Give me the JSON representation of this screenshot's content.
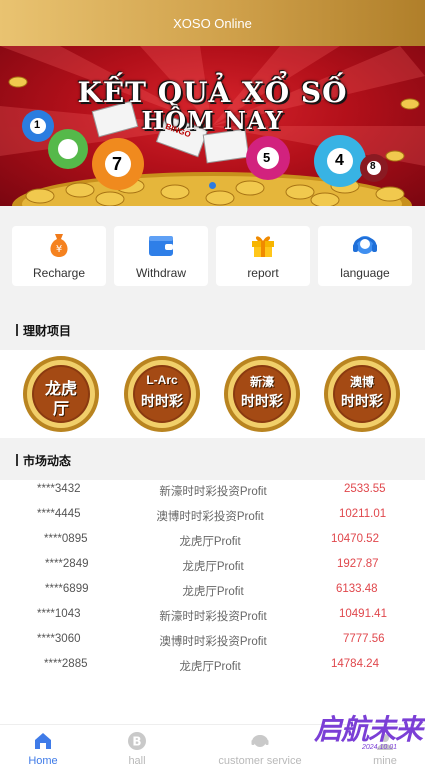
{
  "header": {
    "title": "XOSO Online"
  },
  "banner": {
    "line1": "KẾT QUẢ XỔ SỐ",
    "line2": "HÔM NAY",
    "ticket_text": "BINGO",
    "balls": [
      "1",
      "7",
      "5",
      "4",
      "8"
    ]
  },
  "quick_actions": [
    {
      "label": "Recharge",
      "icon": "money-bag-icon"
    },
    {
      "label": "Withdraw",
      "icon": "wallet-icon"
    },
    {
      "label": "report",
      "icon": "gift-icon"
    },
    {
      "label": "language",
      "icon": "headset-icon"
    }
  ],
  "projects_section": {
    "title": "理财项目"
  },
  "projects": [
    {
      "top": "龙虎",
      "bottom": "厅"
    },
    {
      "top": "L-Arc",
      "bottom": "时时彩"
    },
    {
      "top": "新濠",
      "bottom": "时时彩"
    },
    {
      "top": "澳博",
      "bottom": "时时彩"
    }
  ],
  "market_section": {
    "title": "市场动态"
  },
  "market": [
    {
      "user": "****3432",
      "project": "新濠时时彩投资Profit",
      "amount": "2533.55"
    },
    {
      "user": "****4445",
      "project": "澳博时时彩投资Profit",
      "amount": "10211.01"
    },
    {
      "user": "****0895",
      "project": "龙虎厅Profit",
      "amount": "10470.52"
    },
    {
      "user": "****2849",
      "project": "龙虎厅Profit",
      "amount": "1927.87"
    },
    {
      "user": "****6899",
      "project": "龙虎厅Profit",
      "amount": "6133.48"
    },
    {
      "user": "****1043",
      "project": "新濠时时彩投资Profit",
      "amount": "10491.41"
    },
    {
      "user": "****3060",
      "project": "澳博时时彩投资Profit",
      "amount": "7777.56"
    },
    {
      "user": "****2885",
      "project": "龙虎厅Profit",
      "amount": "14784.24"
    }
  ],
  "tabs": [
    {
      "label": "Home",
      "icon": "home-icon",
      "active": true
    },
    {
      "label": "hall",
      "icon": "bitcoin-icon",
      "active": false
    },
    {
      "label": "customer service",
      "icon": "support-icon",
      "active": false
    },
    {
      "label": "mine",
      "icon": "user-icon",
      "active": false
    }
  ],
  "watermark": {
    "text": "启航未来",
    "sub": "2024.10.01"
  },
  "colors": {
    "accent": "#3f7be8",
    "gold": "#cfa04a",
    "amount": "#e0474c",
    "banner_red": "#b3101a"
  }
}
